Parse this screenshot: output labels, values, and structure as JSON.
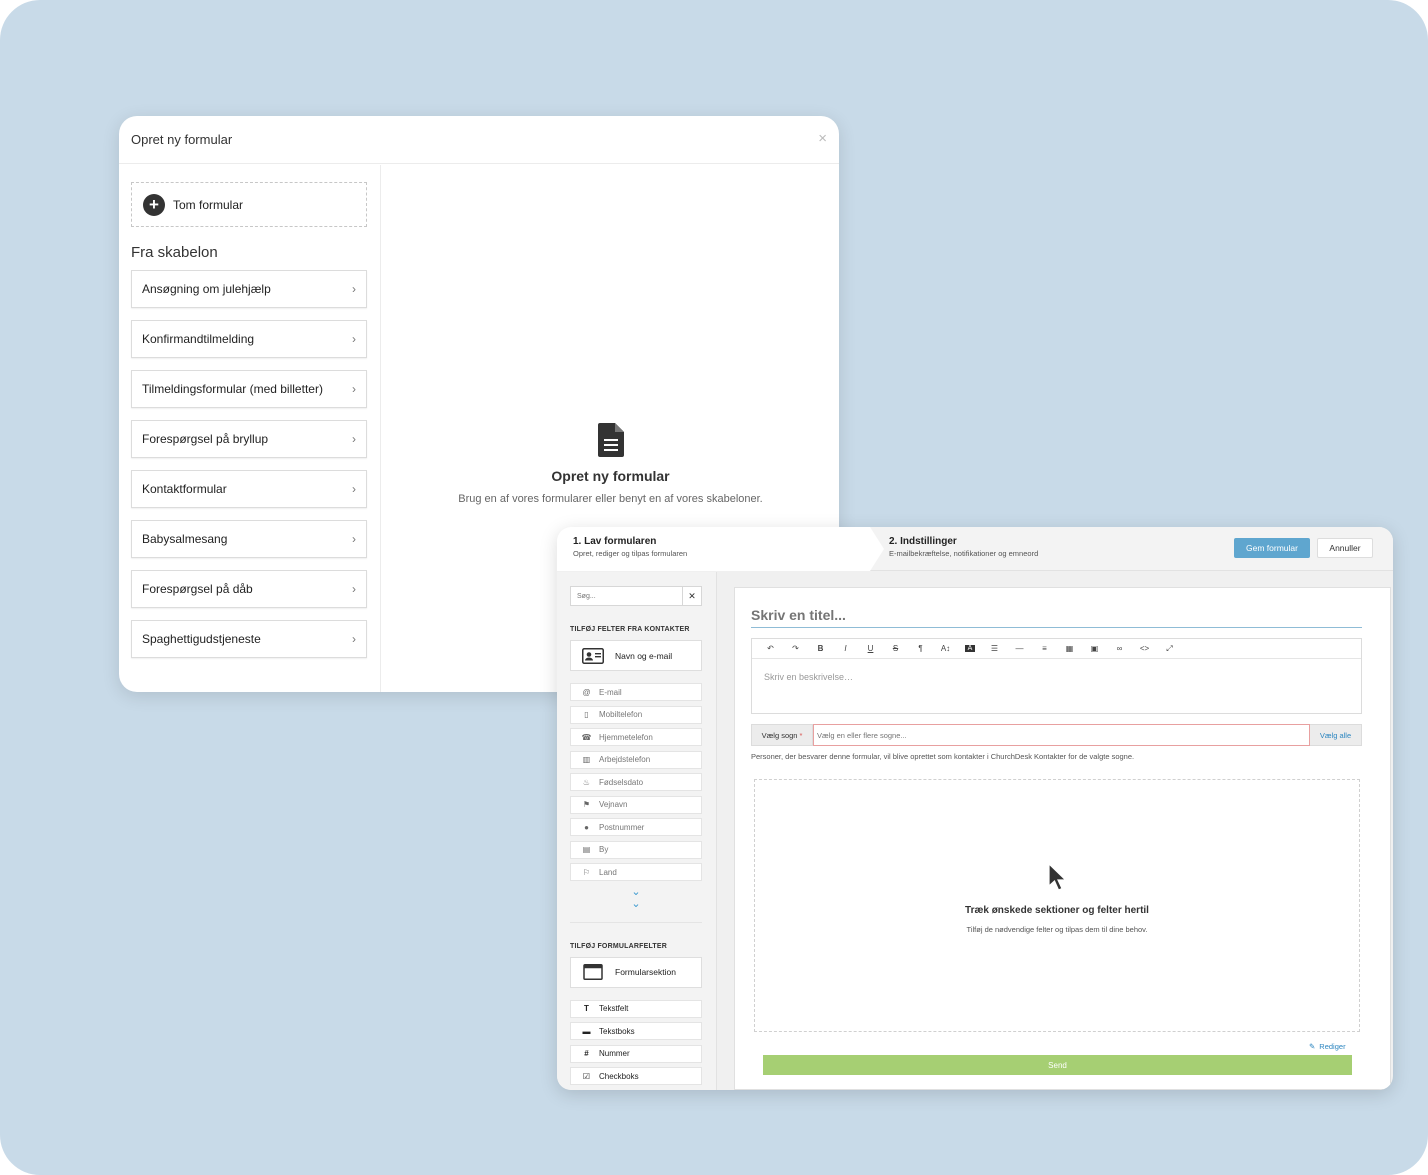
{
  "modal_create": {
    "title": "Opret ny formular",
    "close_glyph": "×",
    "blank_form_label": "Tom formular",
    "from_template_title": "Fra skabelon",
    "templates": [
      "Ansøgning om julehjælp",
      "Konfirmandtilmelding",
      "Tilmeldingsformular (med billetter)",
      "Forespørgsel på bryllup",
      "Kontaktformular",
      "Babysalmesang",
      "Forespørgsel på dåb",
      "Spaghettigudstjeneste"
    ],
    "empty_state": {
      "title": "Opret ny formular",
      "subtitle": "Brug en af vores formularer eller benyt en af vores skabeloner."
    }
  },
  "builder": {
    "steps": [
      {
        "title": "1. Lav formularen",
        "subtitle": "Opret, rediger og tilpas formularen"
      },
      {
        "title": "2. Indstillinger",
        "subtitle": "E-mailbekræftelse, notifikationer og emneord"
      }
    ],
    "save_label": "Gem formular",
    "cancel_label": "Annuller",
    "sidebar": {
      "search_placeholder": "Søg...",
      "contact_fields_heading": "TILFØJ FELTER FRA KONTAKTER",
      "name_email_label": "Navn og e-mail",
      "contact_fields": [
        {
          "label": "E-mail",
          "icon": "at-icon"
        },
        {
          "label": "Mobiltelefon",
          "icon": "mobile-icon"
        },
        {
          "label": "Hjemmetelefon",
          "icon": "phone-icon"
        },
        {
          "label": "Arbejdstelefon",
          "icon": "office-icon"
        },
        {
          "label": "Fødselsdato",
          "icon": "cake-icon"
        },
        {
          "label": "Vejnavn",
          "icon": "road-icon"
        },
        {
          "label": "Postnummer",
          "icon": "map-pin-icon"
        },
        {
          "label": "By",
          "icon": "city-icon"
        },
        {
          "label": "Land",
          "icon": "flag-icon"
        }
      ],
      "form_fields_heading": "TILFØJ FORMULARFELTER",
      "form_section_label": "Formularsektion",
      "form_fields": [
        {
          "label": "Tekstfelt",
          "icon": "text-icon"
        },
        {
          "label": "Tekstboks",
          "icon": "textbox-icon"
        },
        {
          "label": "Nummer",
          "icon": "hash-icon"
        },
        {
          "label": "Checkboks",
          "icon": "checkbox-icon"
        }
      ]
    },
    "canvas": {
      "title_placeholder": "Skriv en titel...",
      "description_placeholder": "Skriv en beskrivelse…",
      "toolbar_glyphs": [
        "↶",
        "↷",
        "B",
        "I",
        "U",
        "S",
        "¶",
        "A↕",
        "A",
        "☰",
        "—",
        "≡",
        "▦",
        "▣",
        "∞",
        "<>",
        "⤢"
      ],
      "parish_label": "Vælg sogn",
      "parish_required": "*",
      "parish_placeholder": "Vælg en eller flere sogne...",
      "parish_select_all": "Vælg alle",
      "parish_help": "Personer, der besvarer denne formular, vil blive oprettet som kontakter i ChurchDesk Kontakter for de valgte sogne.",
      "dropzone_title": "Træk ønskede sektioner og felter hertil",
      "dropzone_subtitle": "Tilføj de nødvendige felter og tilpas dem til dine behov.",
      "edit_label": "Rediger",
      "send_label": "Send"
    }
  },
  "colors": {
    "background": "#c8dae8",
    "primary_button": "#5fa6cf",
    "send_button": "#a6cf73",
    "link": "#2d86c0"
  }
}
